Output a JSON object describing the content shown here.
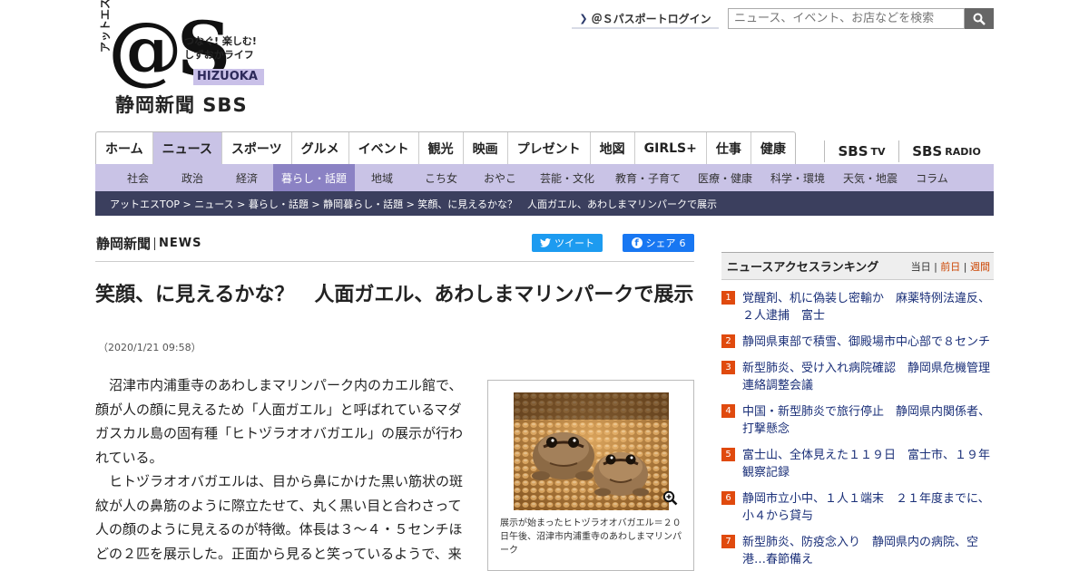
{
  "header": {
    "logo_kana": "アットエス",
    "logo_main": "@S",
    "logo_tag_1": "つなぐ! 楽しむ!",
    "logo_tag_2": "しずおかライフ",
    "logo_hizuoka": "HIZUOKA",
    "logo_newspaper": "静岡新聞 SBS",
    "login_label": "＠Ｓパスポートログイン",
    "search_placeholder": "ニュース、イベント、お店などを検索"
  },
  "main_nav": [
    {
      "label": "ホーム",
      "active": false
    },
    {
      "label": "ニュース",
      "active": true
    },
    {
      "label": "スポーツ",
      "active": false
    },
    {
      "label": "グルメ",
      "active": false
    },
    {
      "label": "イベント",
      "active": false
    },
    {
      "label": "観光",
      "active": false
    },
    {
      "label": "映画",
      "active": false
    },
    {
      "label": "プレゼント",
      "active": false
    },
    {
      "label": "地図",
      "active": false
    },
    {
      "label": "GIRLS+",
      "active": false
    },
    {
      "label": "仕事",
      "active": false
    },
    {
      "label": "健康",
      "active": false
    }
  ],
  "broadcast": {
    "tv_main": "SBS",
    "tv_sub": "TV",
    "radio_main": "SBS",
    "radio_sub": "RADIO"
  },
  "sub_nav": [
    {
      "label": "社会",
      "active": false
    },
    {
      "label": "政治",
      "active": false
    },
    {
      "label": "経済",
      "active": false
    },
    {
      "label": "暮らし・話題",
      "active": true
    },
    {
      "label": "地域",
      "active": false
    },
    {
      "label": "こち女",
      "active": false
    },
    {
      "label": "おやこ",
      "active": false
    },
    {
      "label": "芸能・文化",
      "active": false
    },
    {
      "label": "教育・子育て",
      "active": false
    },
    {
      "label": "医療・健康",
      "active": false
    },
    {
      "label": "科学・環境",
      "active": false
    },
    {
      "label": "天気・地震",
      "active": false
    },
    {
      "label": "コラム",
      "active": false
    }
  ],
  "breadcrumb": "アットエスTOP > ニュース > 暮らし・話題 > 静岡暮らし・話題 > 笑顔、に見えるかな？　人面ガエル、あわしまマリンパークで展示",
  "article": {
    "source_name": "静岡新聞",
    "source_sub": "NEWS",
    "tweet_label": "ツイート",
    "share_label": "シェア",
    "share_count": "6",
    "title": "笑顔、に見えるかな？　人面ガエル、あわしまマリンパークで展示",
    "date": "（2020/1/21 09:58）",
    "paragraphs": [
      "沼津市内浦重寺のあわしまマリンパーク内のカエル館で、顔が人の顔に見えるため「人面ガエル」と呼ばれているマダガスカル島の固有種「ヒトヅラオオバガエル」の展示が行われている。",
      "ヒトヅラオオバガエルは、目から鼻にかけた黒い筋状の斑紋が人の鼻筋のように際立たせて、丸く黒い目と合わさって人の顔のように見えるのが特徴。体長は３～４・５センチほどの２匹を展示した。正面から見ると笑っているようで、来"
    ],
    "caption": "展示が始まったヒトヅラオオバガエル＝２０日午後、沼津市内浦重寺のあわしまマリンパーク"
  },
  "ranking": {
    "title": "ニュースアクセスランキング",
    "period_today": "当日",
    "period_prev": "前日",
    "period_week": "週間",
    "items": [
      {
        "rank": "1",
        "text": "覚醒剤、机に偽装し密輸か　麻薬特例法違反、２人逮捕　富士"
      },
      {
        "rank": "2",
        "text": "静岡県東部で積雪、御殿場市中心部で８センチ"
      },
      {
        "rank": "3",
        "text": "新型肺炎、受け入れ病院確認　静岡県危機管理連絡調整会議"
      },
      {
        "rank": "4",
        "text": "中国・新型肺炎で旅行停止　静岡県内関係者、打撃懸念"
      },
      {
        "rank": "5",
        "text": "富士山、全体見えた１１９日　富士市、１９年観察記録"
      },
      {
        "rank": "6",
        "text": "静岡市立小中、１人１端末　２１年度までに、小４から貸与"
      },
      {
        "rank": "7",
        "text": "新型肺炎、防疫念入り　静岡県内の病院、空港…春節備え"
      }
    ]
  },
  "colors": {
    "nav_active": "#c9c3e6",
    "subnav_active": "#8b82c4",
    "breadcrumb_bg": "#3b3f5e",
    "rank_badge": "#e04a0e",
    "twitter": "#1d9bf0",
    "facebook": "#1877f2"
  }
}
